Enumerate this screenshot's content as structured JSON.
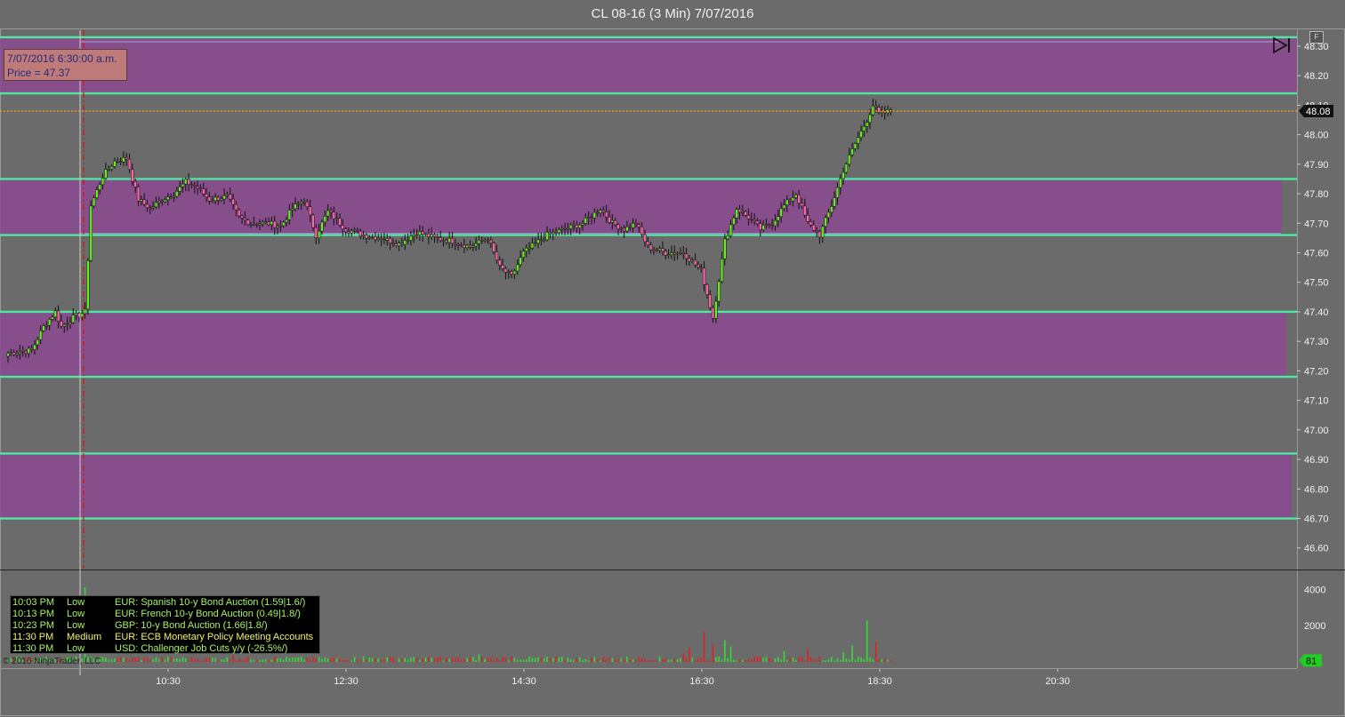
{
  "window": {
    "title": "CL 08-16 (3 Min)  7/07/2016"
  },
  "tooltip": {
    "line1": "7/07/2016 6:30:00 a.m.",
    "line2": "Price = 47.37"
  },
  "news": [
    {
      "time": "10:03 PM",
      "impact": "Low",
      "desc": "EUR: Spanish 10-y Bond Auction (1.59|1.6/)",
      "color": "#a8f060"
    },
    {
      "time": "10:13 PM",
      "impact": "Low",
      "desc": "EUR: French 10-y Bond Auction (0.49|1.8/)",
      "color": "#a8f060"
    },
    {
      "time": "10:23 PM",
      "impact": "Low",
      "desc": "GBP: 10-y Bond Auction (1.66|1.8/)",
      "color": "#a8f060"
    },
    {
      "time": "11:30 PM",
      "impact": "Medium",
      "desc": "EUR: ECB Monetary Policy Meeting Accounts",
      "color": "#f0f070"
    },
    {
      "time": "11:30 PM",
      "impact": "Low",
      "desc": "USD: Challenger Job Cuts y/y (-26.5%/)",
      "color": "#a8f060"
    }
  ],
  "footer": {
    "copyright": "© 2016 NinjaTrader, LLC"
  },
  "buttons": {
    "f_label": "F"
  },
  "colors": {
    "background": "#6b6b6b",
    "up": "#66ee22",
    "down": "#ff66aa",
    "zone": "#8a4a8e",
    "zone_line": "#4ee8a0",
    "volume_up": "#33dd33",
    "volume_down": "#dd2222"
  },
  "chart_data": {
    "type": "candlestick",
    "symbol": "CL 08-16",
    "interval": "3 Min",
    "ylim": [
      46.53,
      48.36
    ],
    "yticks": [
      "48.30",
      "48.20",
      "48.10",
      "48.00",
      "47.90",
      "47.80",
      "47.70",
      "47.60",
      "47.50",
      "47.40",
      "47.30",
      "47.20",
      "47.10",
      "47.00",
      "46.90",
      "46.80",
      "46.70",
      "46.60"
    ],
    "time_ticks": [
      "10:30",
      "12:30",
      "14:30",
      "16:30",
      "18:30",
      "20:30"
    ],
    "last_price": "48.08",
    "volume_ticks": [
      "4000",
      "2000"
    ],
    "volume_last": "81",
    "zones": [
      {
        "low": 48.14,
        "high": 48.33
      },
      {
        "low": 47.66,
        "high": 47.85
      },
      {
        "low": 47.18,
        "high": 47.4
      },
      {
        "low": 46.7,
        "high": 46.92
      }
    ],
    "crosshair_time": "6:30",
    "crosshair_price": 47.37,
    "price_path": [
      [
        0,
        47.26
      ],
      [
        8,
        47.27
      ],
      [
        12,
        47.35
      ],
      [
        16,
        47.4
      ],
      [
        18,
        47.35
      ],
      [
        22,
        47.38
      ],
      [
        26,
        47.4
      ],
      [
        28,
        47.76
      ],
      [
        32,
        47.86
      ],
      [
        36,
        47.91
      ],
      [
        40,
        47.92
      ],
      [
        44,
        47.78
      ],
      [
        48,
        47.75
      ],
      [
        52,
        47.78
      ],
      [
        56,
        47.8
      ],
      [
        60,
        47.84
      ],
      [
        64,
        47.82
      ],
      [
        68,
        47.78
      ],
      [
        74,
        47.79
      ],
      [
        78,
        47.72
      ],
      [
        82,
        47.7
      ],
      [
        88,
        47.7
      ],
      [
        92,
        47.69
      ],
      [
        96,
        47.75
      ],
      [
        100,
        47.78
      ],
      [
        104,
        47.66
      ],
      [
        108,
        47.74
      ],
      [
        114,
        47.68
      ],
      [
        120,
        47.66
      ],
      [
        126,
        47.65
      ],
      [
        132,
        47.63
      ],
      [
        138,
        47.67
      ],
      [
        144,
        47.65
      ],
      [
        150,
        47.64
      ],
      [
        156,
        47.62
      ],
      [
        162,
        47.65
      ],
      [
        166,
        47.55
      ],
      [
        170,
        47.52
      ],
      [
        174,
        47.6
      ],
      [
        178,
        47.63
      ],
      [
        182,
        47.66
      ],
      [
        188,
        47.68
      ],
      [
        194,
        47.7
      ],
      [
        200,
        47.75
      ],
      [
        204,
        47.7
      ],
      [
        208,
        47.68
      ],
      [
        212,
        47.7
      ],
      [
        216,
        47.62
      ],
      [
        222,
        47.6
      ],
      [
        228,
        47.6
      ],
      [
        234,
        47.54
      ],
      [
        238,
        47.38
      ],
      [
        242,
        47.64
      ],
      [
        246,
        47.75
      ],
      [
        250,
        47.72
      ],
      [
        254,
        47.68
      ],
      [
        258,
        47.7
      ],
      [
        262,
        47.76
      ],
      [
        266,
        47.8
      ],
      [
        270,
        47.7
      ],
      [
        274,
        47.66
      ],
      [
        278,
        47.76
      ],
      [
        282,
        47.88
      ],
      [
        286,
        47.97
      ],
      [
        290,
        48.05
      ],
      [
        292,
        48.1
      ],
      [
        294,
        48.07
      ],
      [
        298,
        48.08
      ]
    ]
  }
}
